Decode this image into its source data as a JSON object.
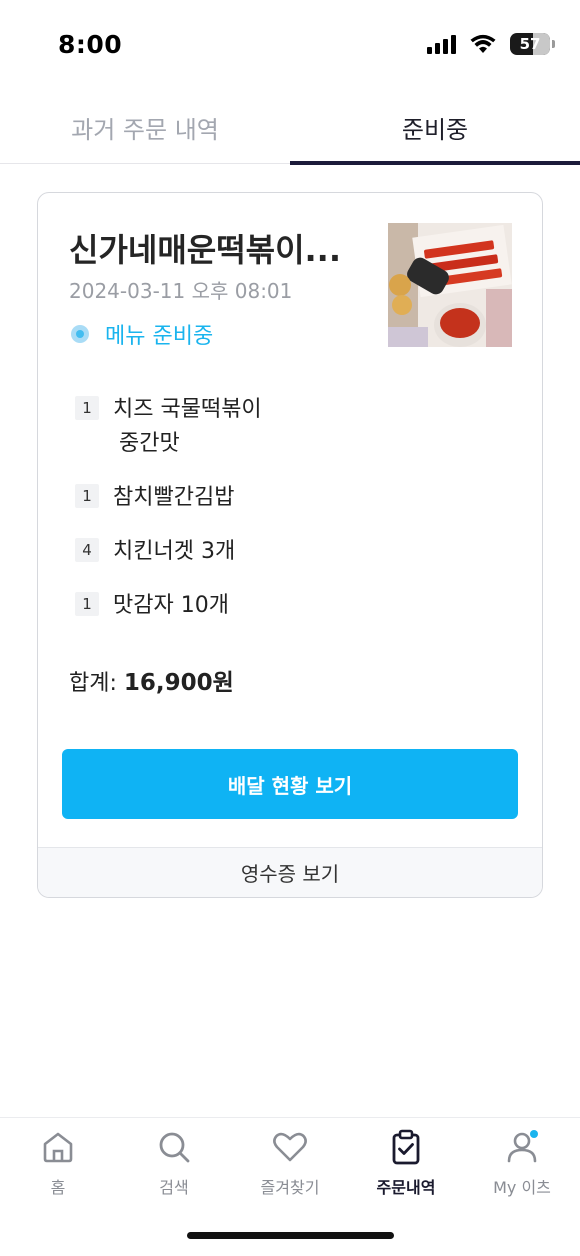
{
  "status_bar": {
    "time": "8:00",
    "battery": "57",
    "battery_level": 0.57
  },
  "tabs": [
    {
      "label": "과거 주문 내역",
      "active": false
    },
    {
      "label": "준비중",
      "active": true
    }
  ],
  "order": {
    "store_name": "신가네매운떡볶이...",
    "date": "2024-03-11 오후 08:01",
    "status": "메뉴 준비중",
    "items": [
      {
        "qty": "1",
        "name": "치즈 국물떡볶이",
        "option": "중간맛"
      },
      {
        "qty": "1",
        "name": "참치빨간김밥",
        "option": ""
      },
      {
        "qty": "4",
        "name": "치킨너겟 3개",
        "option": ""
      },
      {
        "qty": "1",
        "name": "맛감자 10개",
        "option": ""
      }
    ],
    "total_label": "합계:",
    "total_value": "16,900원",
    "track_button": "배달 현황 보기",
    "receipt_button": "영수증 보기"
  },
  "nav": [
    {
      "label": "홈",
      "icon": "home-icon"
    },
    {
      "label": "검색",
      "icon": "search-icon"
    },
    {
      "label": "즐겨찾기",
      "icon": "heart-icon"
    },
    {
      "label": "주문내역",
      "icon": "order-clipboard-icon",
      "active": true
    },
    {
      "label": "My 이츠",
      "icon": "profile-icon"
    }
  ],
  "colors": {
    "accent": "#0fb3f4",
    "status": "#1ab4ee",
    "tab_indicator": "#1c1b3a"
  }
}
